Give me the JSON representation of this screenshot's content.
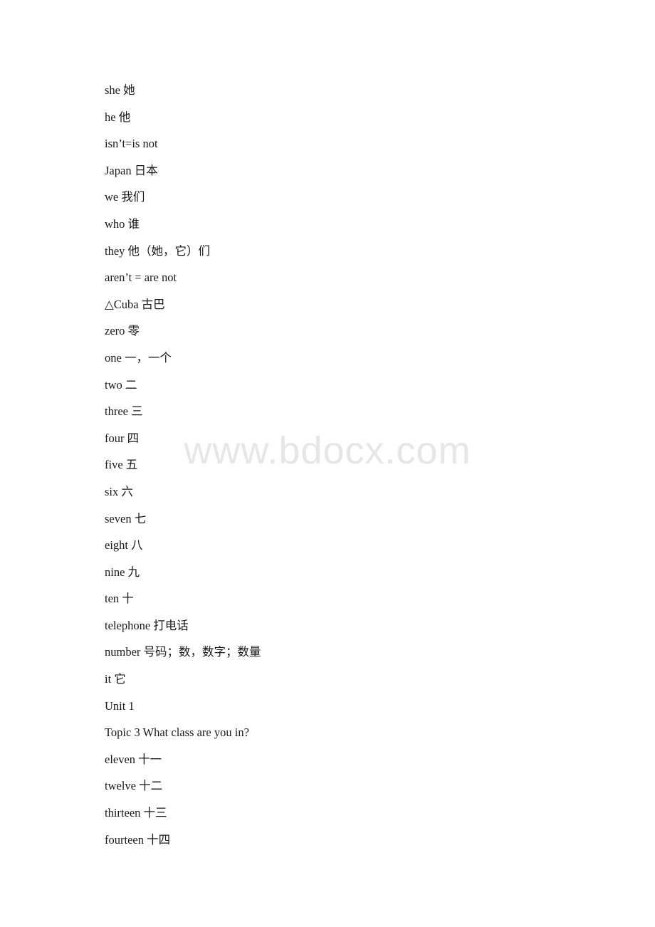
{
  "document": {
    "background_color": "#ffffff",
    "text_color": "#1a1a1a",
    "watermark": {
      "text": "www.bdocx.com",
      "color": "#e6e6e6"
    },
    "lines": [
      {
        "text": "she 她"
      },
      {
        "text": "he 他"
      },
      {
        "text": "isn’t=is not"
      },
      {
        "text": "Japan 日本"
      },
      {
        "text": "we 我们"
      },
      {
        "text": "who 谁"
      },
      {
        "text": "they 他（她，它）们"
      },
      {
        "text": "aren’t = are not"
      },
      {
        "text": "△Cuba 古巴"
      },
      {
        "text": "zero 零"
      },
      {
        "text": "one 一，一个"
      },
      {
        "text": "two 二"
      },
      {
        "text": "three 三"
      },
      {
        "text": "four 四"
      },
      {
        "text": "five 五"
      },
      {
        "text": "six 六"
      },
      {
        "text": "seven 七"
      },
      {
        "text": "eight 八"
      },
      {
        "text": "nine 九"
      },
      {
        "text": "ten 十"
      },
      {
        "text": "telephone 打电话"
      },
      {
        "text": "number 号码；数，数字；数量"
      },
      {
        "text": "it 它"
      },
      {
        "text": "Unit 1"
      },
      {
        "text": "Topic 3 What class are you in?"
      },
      {
        "text": "eleven 十一"
      },
      {
        "text": "twelve 十二"
      },
      {
        "text": "thirteen 十三"
      },
      {
        "text": "fourteen 十四"
      }
    ]
  }
}
